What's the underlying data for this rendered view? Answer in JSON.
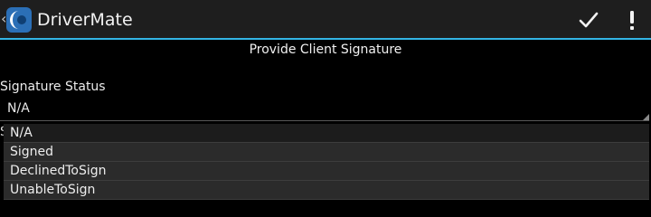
{
  "action_bar": {
    "title": "DriverMate",
    "up_icon": "chevron-left-icon",
    "app_icon": "drivermate-logo-icon",
    "actions": [
      {
        "icon": "check-icon"
      },
      {
        "icon": "exclamation-icon"
      }
    ],
    "accent_color": "#33b5e5"
  },
  "page": {
    "header": "Provide Client Signature",
    "signature_status": {
      "label": "Signature Status",
      "value": "N/A"
    },
    "next_field_label_partial": "S"
  },
  "dropdown": {
    "options": [
      "N/A",
      "Signed",
      "DeclinedToSign",
      "UnableToSign"
    ],
    "selected": "N/A"
  }
}
